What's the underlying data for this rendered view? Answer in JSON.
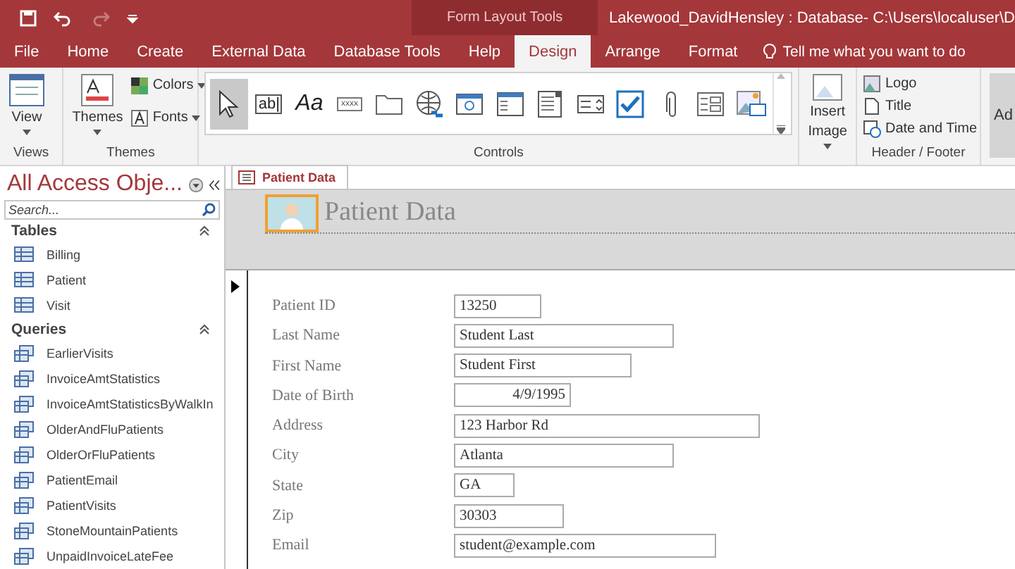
{
  "title_bar": {
    "contextual": "Form Layout Tools",
    "title": "Lakewood_DavidHensley : Database- C:\\Users\\localuser\\D",
    "redo_disabled": true
  },
  "ribbon_tabs": [
    {
      "label": "File",
      "selected": false
    },
    {
      "label": "Home",
      "selected": false
    },
    {
      "label": "Create",
      "selected": false
    },
    {
      "label": "External Data",
      "selected": false
    },
    {
      "label": "Database Tools",
      "selected": false
    },
    {
      "label": "Help",
      "selected": false
    },
    {
      "label": "Design",
      "selected": true
    },
    {
      "label": "Arrange",
      "selected": false
    },
    {
      "label": "Format",
      "selected": false
    }
  ],
  "tell_me": "Tell me what you want to do",
  "views_group": {
    "label": "Views",
    "button": "View"
  },
  "themes_group": {
    "label": "Themes",
    "themes": "Themes",
    "colors": "Colors",
    "fonts": "Fonts"
  },
  "controls_group": {
    "label": "Controls",
    "items": [
      {
        "kind": "pointer",
        "selected": true
      },
      {
        "kind": "textbox",
        "glyph": "ab|",
        "selected": false
      },
      {
        "kind": "label",
        "glyph": "Aa",
        "selected": false
      },
      {
        "kind": "button",
        "glyph": "xxxx",
        "selected": false
      },
      {
        "kind": "tab",
        "selected": false
      },
      {
        "kind": "hyperlink",
        "selected": false
      },
      {
        "kind": "browser",
        "selected": false
      },
      {
        "kind": "navigation",
        "selected": false
      },
      {
        "kind": "listbox",
        "selected": false
      },
      {
        "kind": "combo",
        "selected": false
      },
      {
        "kind": "checkbox",
        "selected": false
      },
      {
        "kind": "attachment",
        "selected": false
      },
      {
        "kind": "option",
        "selected": false
      },
      {
        "kind": "image",
        "selected": false
      }
    ]
  },
  "insert_image": {
    "line_1": "Insert",
    "line_2": "Image"
  },
  "header_footer": {
    "label": "Header / Footer",
    "items": [
      {
        "kind": "logo",
        "label": "Logo"
      },
      {
        "kind": "title",
        "label": "Title"
      },
      {
        "kind": "datetime",
        "label": "Date and Time"
      }
    ]
  },
  "add_existing": "Ad",
  "nav_pane": {
    "title": "All Access Obje...",
    "search_placeholder": "Search...",
    "groups": [
      {
        "name": "Tables",
        "expanded": true,
        "items": [
          {
            "label": "Billing",
            "kind": "table"
          },
          {
            "label": "Patient",
            "kind": "table"
          },
          {
            "label": "Visit",
            "kind": "table"
          }
        ]
      },
      {
        "name": "Queries",
        "expanded": true,
        "items": [
          {
            "label": "EarlierVisits",
            "kind": "query"
          },
          {
            "label": "InvoiceAmtStatistics",
            "kind": "query"
          },
          {
            "label": "InvoiceAmtStatisticsByWalkIn",
            "kind": "query"
          },
          {
            "label": "OlderAndFluPatients",
            "kind": "query"
          },
          {
            "label": "OlderOrFluPatients",
            "kind": "query"
          },
          {
            "label": "PatientEmail",
            "kind": "query"
          },
          {
            "label": "PatientVisits",
            "kind": "query"
          },
          {
            "label": "StoneMountainPatients",
            "kind": "query"
          },
          {
            "label": "UnpaidInvoiceLateFee",
            "kind": "query"
          }
        ]
      }
    ]
  },
  "document_tab": {
    "label": "Patient Data"
  },
  "form": {
    "title": "Patient Data",
    "fields": [
      {
        "label": "Patient ID",
        "value": "13250",
        "kind": "number"
      },
      {
        "label": "Last Name",
        "value": "Student Last",
        "kind": "text"
      },
      {
        "label": "First Name",
        "value": "Student First",
        "kind": "text"
      },
      {
        "label": "Date of Birth",
        "value": "4/9/1995",
        "kind": "date"
      },
      {
        "label": "Address",
        "value": "123 Harbor Rd",
        "kind": "text"
      },
      {
        "label": "City",
        "value": "Atlanta",
        "kind": "text"
      },
      {
        "label": "State",
        "value": "GA",
        "kind": "text"
      },
      {
        "label": "Zip",
        "value": "30303",
        "kind": "text"
      },
      {
        "label": "Email",
        "value": "student@example.com",
        "kind": "text"
      }
    ]
  }
}
